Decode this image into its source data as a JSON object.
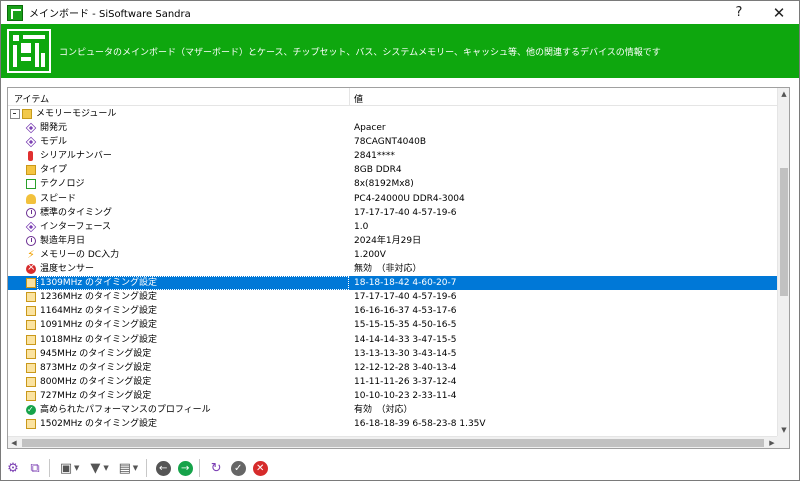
{
  "window": {
    "title": "メインボード - SiSoftware Sandra",
    "help_label": "?",
    "close_label": "✕"
  },
  "banner": {
    "description": "コンピュータのメインボード（マザーボード）とケース、チップセット、バス、システムメモリー、キャッシュ等、他の関連するデバイスの情報です"
  },
  "table": {
    "header_item": "アイテム",
    "header_value": "値",
    "rows": [
      {
        "label": "メモリーモジュール",
        "value": "",
        "icon": "folder-icon",
        "indent": 0
      },
      {
        "label": "開発元",
        "value": "Apacer",
        "icon": "diamond-icon",
        "indent": 1
      },
      {
        "label": "モデル",
        "value": "78CAGNT4040B",
        "icon": "diamond-icon",
        "indent": 1
      },
      {
        "label": "シリアルナンバー",
        "value": "2841****",
        "icon": "thermometer-icon",
        "indent": 1
      },
      {
        "label": "タイプ",
        "value": "8GB DDR4",
        "icon": "memory-type-icon",
        "indent": 1
      },
      {
        "label": "テクノロジ",
        "value": "8x(8192Mx8)",
        "icon": "chip-icon",
        "indent": 1
      },
      {
        "label": "スピード",
        "value": "PC4-24000U DDR4-3004",
        "icon": "key-icon",
        "indent": 1
      },
      {
        "label": "標準のタイミング",
        "value": "17-17-17-40 4-57-19-6",
        "icon": "clock-icon",
        "indent": 1
      },
      {
        "label": "インターフェース",
        "value": "1.0",
        "icon": "diamond-icon",
        "indent": 1
      },
      {
        "label": "製造年月日",
        "value": "2024年1月29日",
        "icon": "clock-icon",
        "indent": 1
      },
      {
        "label": "メモリーの DC入力",
        "value": "1.200V",
        "icon": "bolt-icon",
        "indent": 1
      },
      {
        "label": "温度センサー",
        "value": "無効　（非対応）",
        "icon": "error-icon",
        "indent": 1
      },
      {
        "label": "1309MHz のタイミング設定",
        "value": "18-18-18-42 4-60-20-7",
        "icon": "timing-icon",
        "indent": 1,
        "selected": true
      },
      {
        "label": "1236MHz のタイミング設定",
        "value": "17-17-17-40 4-57-19-6",
        "icon": "timing-icon",
        "indent": 1
      },
      {
        "label": "1164MHz のタイミング設定",
        "value": "16-16-16-37 4-53-17-6",
        "icon": "timing-icon",
        "indent": 1
      },
      {
        "label": "1091MHz のタイミング設定",
        "value": "15-15-15-35 4-50-16-5",
        "icon": "timing-icon",
        "indent": 1
      },
      {
        "label": "1018MHz のタイミング設定",
        "value": "14-14-14-33 3-47-15-5",
        "icon": "timing-icon",
        "indent": 1
      },
      {
        "label": "945MHz のタイミング設定",
        "value": "13-13-13-30 3-43-14-5",
        "icon": "timing-icon",
        "indent": 1
      },
      {
        "label": "873MHz のタイミング設定",
        "value": "12-12-12-28 3-40-13-4",
        "icon": "timing-icon",
        "indent": 1
      },
      {
        "label": "800MHz のタイミング設定",
        "value": "11-11-11-26 3-37-12-4",
        "icon": "timing-icon",
        "indent": 1
      },
      {
        "label": "727MHz のタイミング設定",
        "value": "10-10-10-23 2-33-11-4",
        "icon": "timing-icon",
        "indent": 1
      },
      {
        "label": "高められたパフォーマンスのプロフィール",
        "value": "有効　（対応）",
        "icon": "check-icon",
        "indent": 1
      },
      {
        "label": "1502MHz のタイミング設定",
        "value": "16-18-18-39 6-58-23-8 1.35V",
        "icon": "timing-icon",
        "indent": 1
      }
    ]
  },
  "toolbar": {
    "buttons": [
      "options-gear-icon",
      "copy-icon",
      "save-icon",
      "filter-icon",
      "chart-icon",
      "back-icon",
      "forward-icon",
      "refresh-icon",
      "ok-icon",
      "cancel-icon"
    ]
  },
  "colors": {
    "banner_green": "#0ea70e",
    "selection_blue": "#0078d7"
  }
}
